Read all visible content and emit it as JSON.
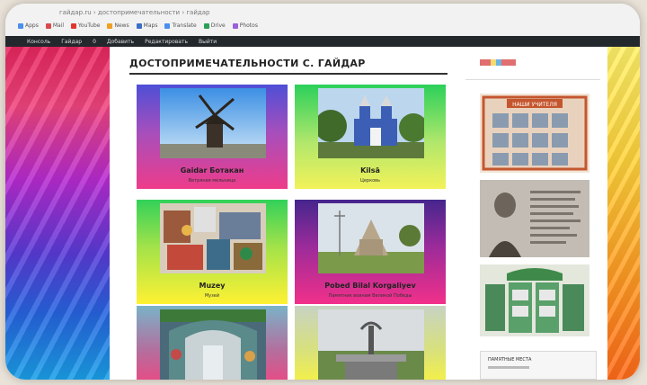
{
  "page": {
    "title": "ДОСТОПРИМЕЧАТЕЛЬНОСТИ С. ГАЙДАР"
  },
  "browser": {
    "url": "гайдар.ru › достопримечательности › гайдар",
    "bookmarks": [
      "Apps",
      "Mail",
      "YouTube",
      "News",
      "Maps",
      "Translate",
      "Drive",
      "Photos"
    ]
  },
  "admin_bar": {
    "items": [
      "Консоль",
      "Гайдар",
      "0",
      "Добавить",
      "Редактировать",
      "Выйти"
    ]
  },
  "cards": [
    {
      "caption": "Gaidar Ботакан",
      "subtitle": "Ветряная мельница"
    },
    {
      "caption": "Kilsā",
      "subtitle": "Церковь"
    },
    {
      "caption": "Muzey",
      "subtitle": "Музей"
    },
    {
      "caption": "Pobed Bilal Korgaliyev",
      "subtitle": "Памятник воинам Великой Победы"
    },
    {
      "caption": "",
      "subtitle": ""
    },
    {
      "caption": "",
      "subtitle": ""
    }
  ],
  "sidebar": {
    "board_title": "НАШИ УЧИТЕЛЯ",
    "widget_title": "ПАМЯТНЫЕ МЕСТА"
  },
  "colors": {
    "admin_bar": "#23282d",
    "accent_pink": "#ee3c8a",
    "accent_green": "#2bd05a",
    "accent_yellow": "#f3f259"
  }
}
